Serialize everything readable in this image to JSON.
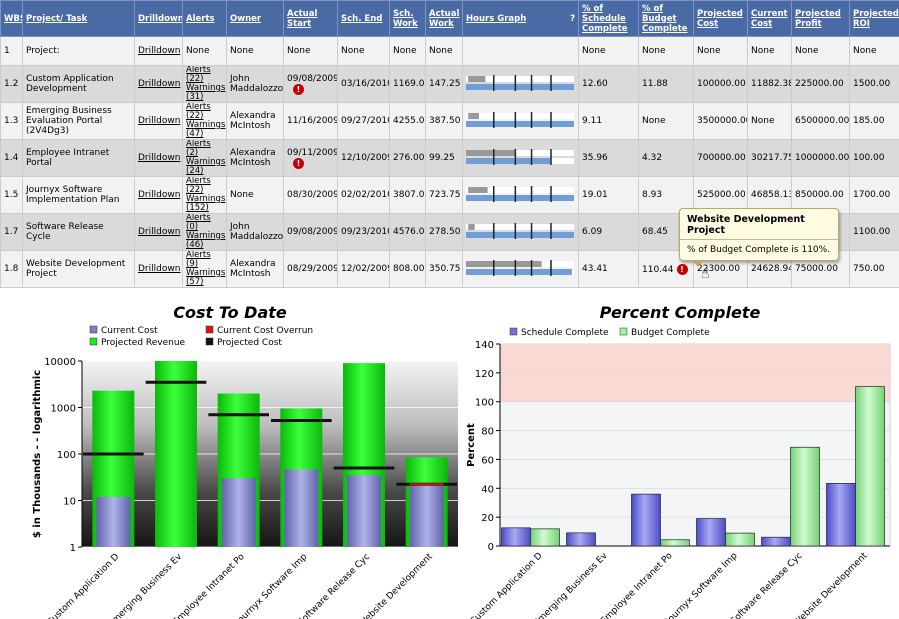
{
  "table": {
    "columns": [
      "WBS",
      "Project/ Task",
      "Drilldown",
      "Alerts",
      "Owner",
      "Actual Start",
      "Sch. End",
      "Sch. Work",
      "Actual Work",
      "Hours Graph",
      "% of Schedule Complete",
      "% of Budget Complete",
      "Projected Cost",
      "Current Cost",
      "Projected Profit",
      "Projected ROI"
    ],
    "hours_graph_help": "?",
    "rows": [
      {
        "wbs": "1",
        "task": "Project:",
        "drilldown": "Drilldown",
        "alerts": "None",
        "owner": "None",
        "start": "None",
        "end": "None",
        "sch_work": "None",
        "act_work": "None",
        "sched_pct": "None",
        "budget_pct": "None",
        "proj_cost": "None",
        "cur_cost": "None",
        "proj_profit": "None",
        "roi": "None",
        "warn": false,
        "graph": null
      },
      {
        "wbs": "1.2",
        "task": "Custom Application Development",
        "drilldown": "Drilldown",
        "alerts": "Alerts (22)",
        "warnings": "Warnings (31)",
        "owner": "John Maddalozzo",
        "start": "09/08/2009",
        "end": "03/16/2010",
        "sch_work": "1169.00",
        "act_work": "147.25",
        "sched_pct": "12.60",
        "budget_pct": "11.88",
        "proj_cost": "100000.00",
        "cur_cost": "11882.38",
        "proj_profit": "225000.00",
        "roi": "1500.00",
        "warn": true,
        "graph": {
          "gray": [
            0.02,
            0.18
          ],
          "blue": [
            0.0,
            1.0
          ]
        }
      },
      {
        "wbs": "1.3",
        "task": "Emerging Business Evaluation Portal (2V4Dg3)",
        "drilldown": "Drilldown",
        "alerts": "Alerts (22)",
        "warnings": "Warnings (47)",
        "owner": "Alexandra McIntosh",
        "start": "11/16/2009",
        "end": "09/27/2010",
        "sch_work": "4255.00",
        "act_work": "387.50",
        "sched_pct": "9.11",
        "budget_pct": "None",
        "proj_cost": "3500000.00",
        "cur_cost": "None",
        "proj_profit": "6500000.00",
        "roi": "185.00",
        "warn": false,
        "graph": {
          "gray": [
            0.02,
            0.12
          ],
          "blue": [
            0.0,
            1.0
          ]
        }
      },
      {
        "wbs": "1.4",
        "task": "Employee Intranet Portal",
        "drilldown": "Drilldown",
        "alerts": "Alerts (2)",
        "warnings": "Warnings (24)",
        "owner": "Alexandra McIntosh",
        "start": "09/11/2009",
        "end": "12/10/2009",
        "sch_work": "276.00",
        "act_work": "99.25",
        "sched_pct": "35.96",
        "budget_pct": "4.32",
        "proj_cost": "700000.00",
        "cur_cost": "30217.75",
        "proj_profit": "1000000.00",
        "roi": "100.00",
        "warn": true,
        "graph": {
          "gray": [
            0.0,
            0.45
          ],
          "blue": [
            0.0,
            0.78
          ]
        }
      },
      {
        "wbs": "1.5",
        "task": "Journyx Software Implementation Plan",
        "drilldown": "Drilldown",
        "alerts": "Alerts (22)",
        "warnings": "Warnings (152)",
        "owner": "None",
        "start": "08/30/2009",
        "end": "02/02/2010",
        "sch_work": "3807.00",
        "act_work": "723.75",
        "sched_pct": "19.01",
        "budget_pct": "8.93",
        "proj_cost": "525000.00",
        "cur_cost": "46858.13",
        "proj_profit": "850000.00",
        "roi": "1700.00",
        "warn": false,
        "graph": {
          "gray": [
            0.02,
            0.2
          ],
          "blue": [
            0.0,
            1.0
          ]
        }
      },
      {
        "wbs": "1.7",
        "task": "Software Release Cycle",
        "drilldown": "Drilldown",
        "alerts": "Alerts (0)",
        "warnings": "Warnings (46)",
        "owner": "John Maddalozzo",
        "start": "09/08/2009",
        "end": "09/23/2010",
        "sch_work": "4576.00",
        "act_work": "278.50",
        "sched_pct": "6.09",
        "budget_pct": "68.45",
        "proj_cost": "",
        "cur_cost": "",
        "proj_profit": "00.00",
        "roi": "1100.00",
        "warn": false,
        "graph": {
          "gray": [
            0.02,
            0.08
          ],
          "blue": [
            0.0,
            1.0
          ]
        }
      },
      {
        "wbs": "1.8",
        "task": "Website Development Project",
        "drilldown": "Drilldown",
        "alerts": "Alerts (9)",
        "warnings": "Warnings (57)",
        "owner": "Alexandra McIntosh",
        "start": "08/29/2009",
        "end": "12/02/2009",
        "sch_work": "808.00",
        "act_work": "350.75",
        "sched_pct": "43.41",
        "budget_pct": "110.44",
        "proj_cost": "22300.00",
        "cur_cost": "24628.94",
        "proj_profit": "75000.00",
        "roi": "750.00",
        "warn": false,
        "budget_warn": true,
        "graph": {
          "gray": [
            0.0,
            0.7
          ],
          "blue": [
            0.0,
            0.98
          ]
        }
      }
    ]
  },
  "tooltip": {
    "title": "Website Development Project",
    "body": "% of Budget Complete is 110%."
  },
  "colors": {
    "header_bg": "#4a6aa5",
    "current_cost": "#7b7fc8",
    "overrun": "#e01010",
    "projected_revenue": "#1ee81e",
    "projected_cost": "#111111",
    "schedule_complete": "#6f6fe0",
    "budget_complete": "#9ff09f",
    "over_100_band": "#fad9d2"
  },
  "chart_data": [
    {
      "type": "bar",
      "title": "Cost To Date",
      "ylabel": "$ in Thousands - - logarithmic",
      "yscale": "log",
      "ylim": [
        1,
        10000
      ],
      "yticks": [
        "1",
        "10",
        "100",
        "1000",
        "10000"
      ],
      "categories": [
        "Custom Application D",
        "Emerging Business Ev",
        "Employee Intranet Po",
        "Journyx Software Imp",
        "Software Release Cyc",
        "Website Development"
      ],
      "legend": [
        "Current Cost",
        "Current Cost Overrun",
        "Projected Revenue",
        "Projected Cost"
      ],
      "series": [
        {
          "name": "Current Cost",
          "values": [
            11.9,
            null,
            30.2,
            46.9,
            35,
            22
          ]
        },
        {
          "name": "Projected Revenue",
          "values": [
            2300,
            10000,
            2000,
            950,
            9000,
            85
          ]
        },
        {
          "name": "Projected Cost",
          "values": [
            100,
            3500,
            700,
            525,
            50,
            22.3
          ]
        },
        {
          "name": "Current Cost Overrun",
          "values": [
            0,
            0,
            0,
            0,
            0,
            2.3
          ]
        }
      ]
    },
    {
      "type": "bar",
      "title": "Percent Complete",
      "ylabel": "Percent",
      "ylim": [
        0,
        140
      ],
      "yticks": [
        "0",
        "20",
        "40",
        "60",
        "80",
        "100",
        "120",
        "140"
      ],
      "categories": [
        "Custom Application D",
        "Emerging Business Ev",
        "Employee Intranet Po",
        "Journyx Software Imp",
        "Software Release Cyc",
        "Website Development"
      ],
      "legend": [
        "Schedule Complete",
        "Budget Complete"
      ],
      "series": [
        {
          "name": "Schedule Complete",
          "values": [
            12.6,
            9.11,
            35.96,
            19.01,
            6.09,
            43.41
          ]
        },
        {
          "name": "Budget Complete",
          "values": [
            11.88,
            0,
            4.32,
            8.93,
            68.45,
            110.44
          ]
        }
      ]
    }
  ]
}
